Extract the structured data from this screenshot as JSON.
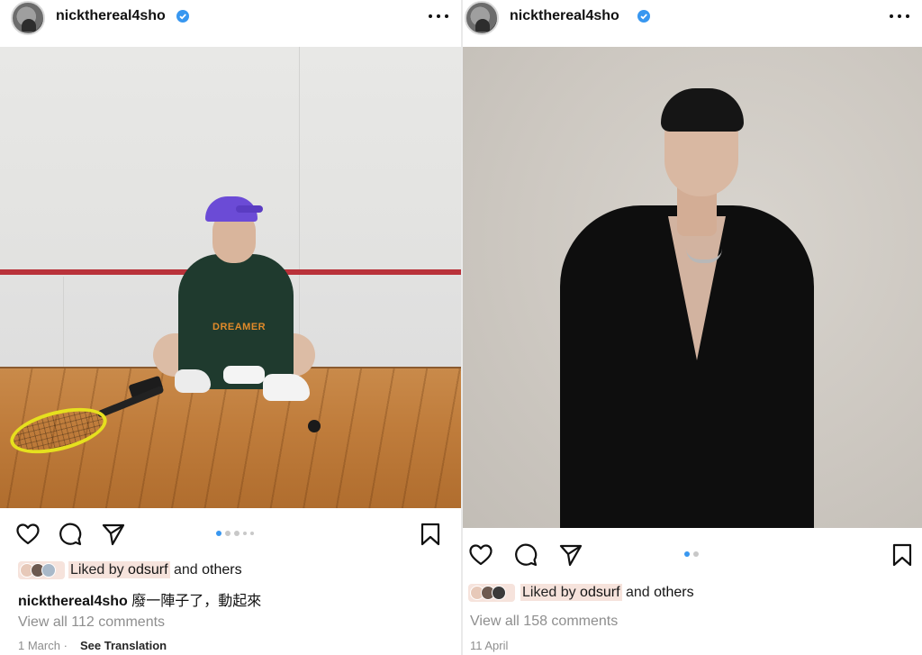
{
  "posts": [
    {
      "username": "nickthereal4sho",
      "verified": true,
      "likes": {
        "prefix": "Liked by",
        "user": "odsurf",
        "and": "and",
        "others": "others"
      },
      "caption": "廢一陣子了，動起來",
      "view_comments": "View all 112 comments",
      "date": "1 March",
      "separator": "·",
      "see_translation": "See Translation",
      "carousel": {
        "count": 5,
        "active": 1
      }
    },
    {
      "username": "nickthereal4sho",
      "verified": true,
      "likes": {
        "prefix": "Liked by",
        "user": "odsurf",
        "and": "and",
        "others": "others"
      },
      "view_comments": "View all 158 comments",
      "date": "11 April",
      "carousel": {
        "count": 2,
        "active": 1
      }
    }
  ],
  "icons": {
    "more": "more-options-icon",
    "like": "heart-icon",
    "comment": "comment-icon",
    "share": "paper-plane-icon",
    "save": "bookmark-icon",
    "verified": "verified-badge-icon"
  },
  "photo_text": {
    "hoodie_print": "DREAMER"
  },
  "colors": {
    "verified": "#3897f0",
    "carousel_active": "#3897f0",
    "muted_text": "#8e8e8e",
    "like_highlight": "#f6e3dc"
  }
}
